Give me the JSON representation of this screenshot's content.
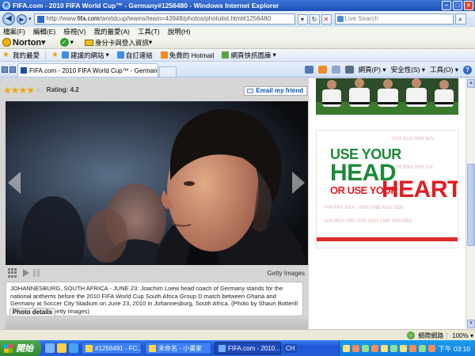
{
  "window": {
    "title": "FIFA.com - 2010 FIFA World Cup™ - Germany#1256480 - Windows Internet Explorer",
    "ie_letter": "e"
  },
  "address": {
    "url_prefix": "http://www.",
    "url_domain": "fifa.com",
    "url_rest": "/worldcup/teams/team=43948/photos/photolist.html#1256480",
    "search_placeholder": "Live Search"
  },
  "menu": [
    "檔案(F)",
    "編輯(E)",
    "檢視(V)",
    "我的最愛(A)",
    "工具(T)",
    "說明(H)"
  ],
  "norton": {
    "logo": "Norton",
    "dropdown": "▾",
    "idsafe": "身分卡與登入資訊",
    "idsafe_dd": "▾"
  },
  "favorites": {
    "label": "我的最愛",
    "links": [
      {
        "text": "建議的網站",
        "dd": "▾",
        "kind": "ie"
      },
      {
        "text": "自訂連結",
        "dd": "",
        "kind": "ie"
      },
      {
        "text": "免費的 Hotmail",
        "dd": "",
        "kind": "hm"
      },
      {
        "text": "網頁快訊圖庫",
        "dd": "▾",
        "kind": "wsg"
      }
    ]
  },
  "tab": {
    "title": "FIFA.com - 2010 FIFA World Cup™ - Germany#1256..."
  },
  "commands": {
    "page": "網頁(P)",
    "safety": "安全性(S)",
    "tools": "工具(O)",
    "help": "?",
    "dd": "▾"
  },
  "photo_page": {
    "rating_stars": 4,
    "rating_label": "Rating: 4.2",
    "email_button": "Email my friend",
    "credit": "Getty Images",
    "caption": "JOHANNESBURG, SOUTH AFRICA - JUNE 23: Joachim Loew head coach of Germany stands for the national anthems before the 2010 FIFA World Cup South Africa Group D match between Ghana and Germany at Soccer City Stadium on June 23, 2010 in Johannesburg, South Africa. (Photo by Shaun Botterill - FIFA/FIFA via Getty Images)",
    "details_tab": "Photo details"
  },
  "ad": {
    "line1": "USE YOUR",
    "line2": "HEAD",
    "line3": "OR USE YOUR",
    "line4": "HEART."
  },
  "status": {
    "zone": "網際網路",
    "zoom": "100%",
    "zoom_dd": "▾"
  },
  "taskbar": {
    "start": "開始",
    "tasks": [
      "#1256491 - FC...",
      "未命名 - 小畫家",
      "FIFA.com - 2010..."
    ],
    "lang": "CH",
    "clock": "下午 03:10"
  },
  "colors": {
    "ad_green": "#1d8a38",
    "ad_red": "#e11c23",
    "star_gold": "#f0a700",
    "xp_blue": "#245edb"
  }
}
